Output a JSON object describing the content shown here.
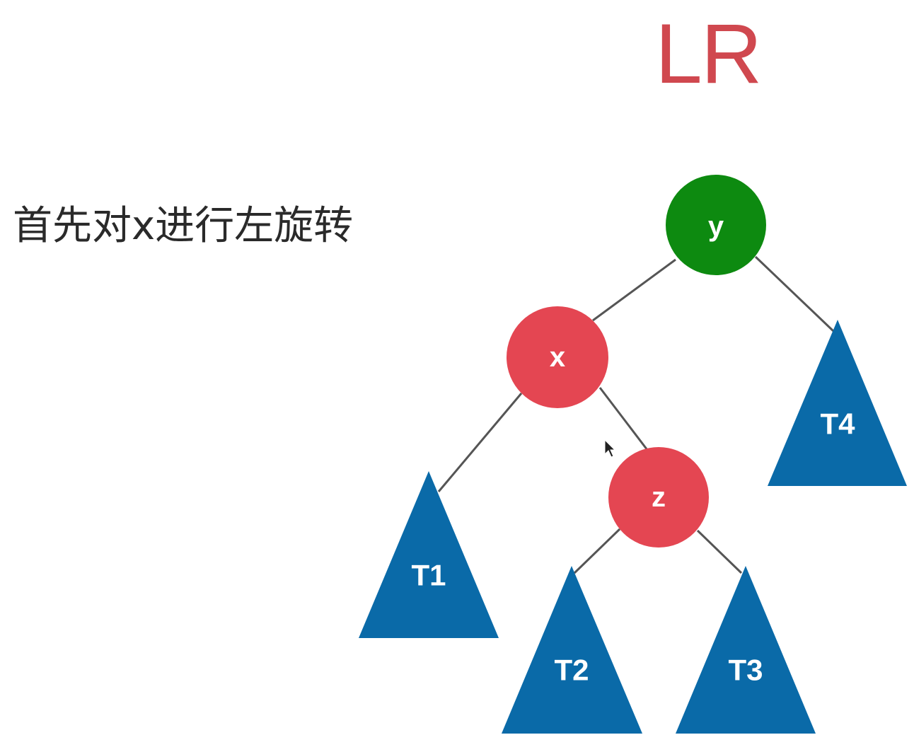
{
  "title": "LR",
  "caption": "首先对x进行左旋转",
  "colors": {
    "title": "#d0484f",
    "root_node": "#0d8a10",
    "child_node": "#e44652",
    "subtree": "#0a6aa8",
    "edge": "#555555"
  },
  "nodes": {
    "y": "y",
    "x": "x",
    "z": "z"
  },
  "subtrees": {
    "t1": "T1",
    "t2": "T2",
    "t3": "T3",
    "t4": "T4"
  },
  "cursor_icon": "mouse-pointer-icon"
}
